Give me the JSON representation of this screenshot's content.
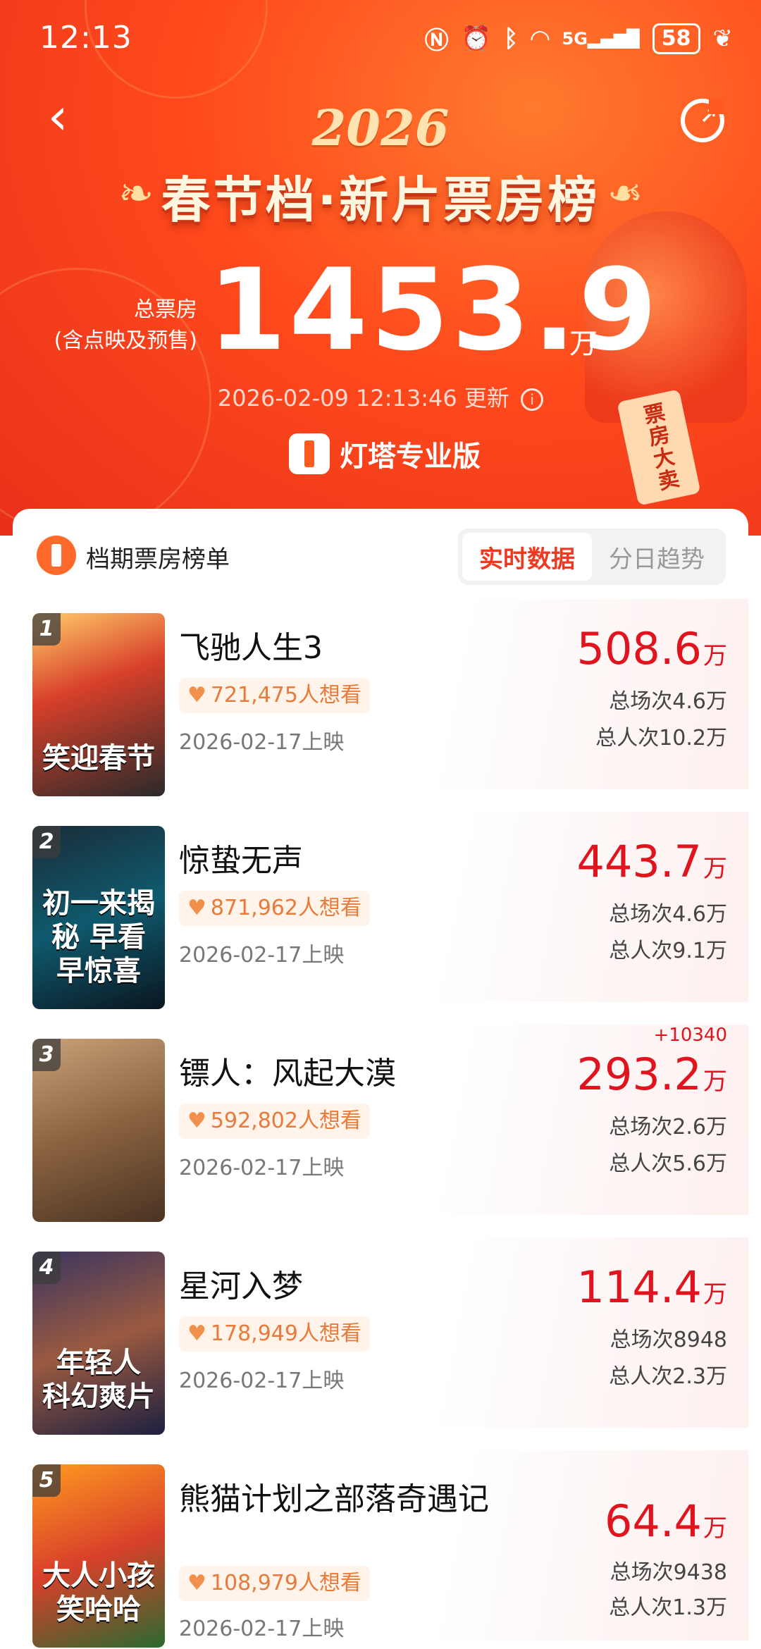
{
  "status_bar": {
    "time": "12:13",
    "signal": "5G",
    "battery": "58"
  },
  "header": {
    "year": "2026",
    "title": "春节档·新片票房榜",
    "total_label_line1": "总票房",
    "total_label_line2": "(含点映及预售)",
    "total_value": "1453.9",
    "total_unit": "万",
    "updated": "2026-02-09 12:13:46 更新",
    "brand": "灯塔专业版",
    "tag": "票房大卖"
  },
  "section": {
    "title": "档期票房榜单",
    "tabs": [
      {
        "label": "实时数据",
        "active": true
      },
      {
        "label": "分日趋势",
        "active": false
      }
    ]
  },
  "movies": [
    {
      "rank": "1",
      "name": "飞驰人生3",
      "poster_text": "笑迎春节",
      "want": "721,475人想看",
      "release": "2026-02-17上映",
      "gross": "508.6",
      "unit": "万",
      "delta": "",
      "shows": "总场次4.6万",
      "audience": "总人次10.2万"
    },
    {
      "rank": "2",
      "name": "惊蛰无声",
      "poster_text": "初一来揭秘 早看早惊喜",
      "want": "871,962人想看",
      "release": "2026-02-17上映",
      "gross": "443.7",
      "unit": "万",
      "delta": "",
      "shows": "总场次4.6万",
      "audience": "总人次9.1万"
    },
    {
      "rank": "3",
      "name": "镖人：风起大漠",
      "poster_text": "",
      "want": "592,802人想看",
      "release": "2026-02-17上映",
      "gross": "293.2",
      "unit": "万",
      "delta": "+10340",
      "shows": "总场次2.6万",
      "audience": "总人次5.6万"
    },
    {
      "rank": "4",
      "name": "星河入梦",
      "poster_text": "年轻人 科幻爽片",
      "want": "178,949人想看",
      "release": "2026-02-17上映",
      "gross": "114.4",
      "unit": "万",
      "delta": "",
      "shows": "总场次8948",
      "audience": "总人次2.3万"
    },
    {
      "rank": "5",
      "name": "熊猫计划之部落奇遇记",
      "poster_text": "大人小孩 笑哈哈",
      "want": "108,979人想看",
      "release": "2026-02-17上映",
      "gross": "64.4",
      "unit": "万",
      "delta": "",
      "shows": "总场次9438",
      "audience": "总人次1.3万"
    }
  ],
  "colors": {
    "accent": "#e0141e",
    "brand_orange": "#ff5a20"
  }
}
